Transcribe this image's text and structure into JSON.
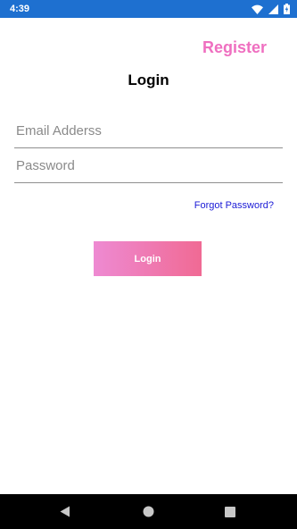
{
  "status_bar": {
    "time": "4:39",
    "icons": [
      "wifi-icon",
      "signal-icon",
      "battery-icon"
    ],
    "background": "#1e70d0"
  },
  "header": {
    "register_label": "Register",
    "register_color": "#ef6fc0"
  },
  "page": {
    "title": "Login"
  },
  "form": {
    "email_placeholder": "Email Adderss",
    "password_placeholder": "Password",
    "forgot_password_label": "Forgot Password?",
    "forgot_password_color": "#1a1ad6",
    "login_button_label": "Login",
    "login_gradient": [
      "#ee8ad2",
      "#f06a94"
    ]
  },
  "nav_bar": {
    "buttons": [
      "back-icon",
      "home-icon",
      "recents-icon"
    ]
  }
}
